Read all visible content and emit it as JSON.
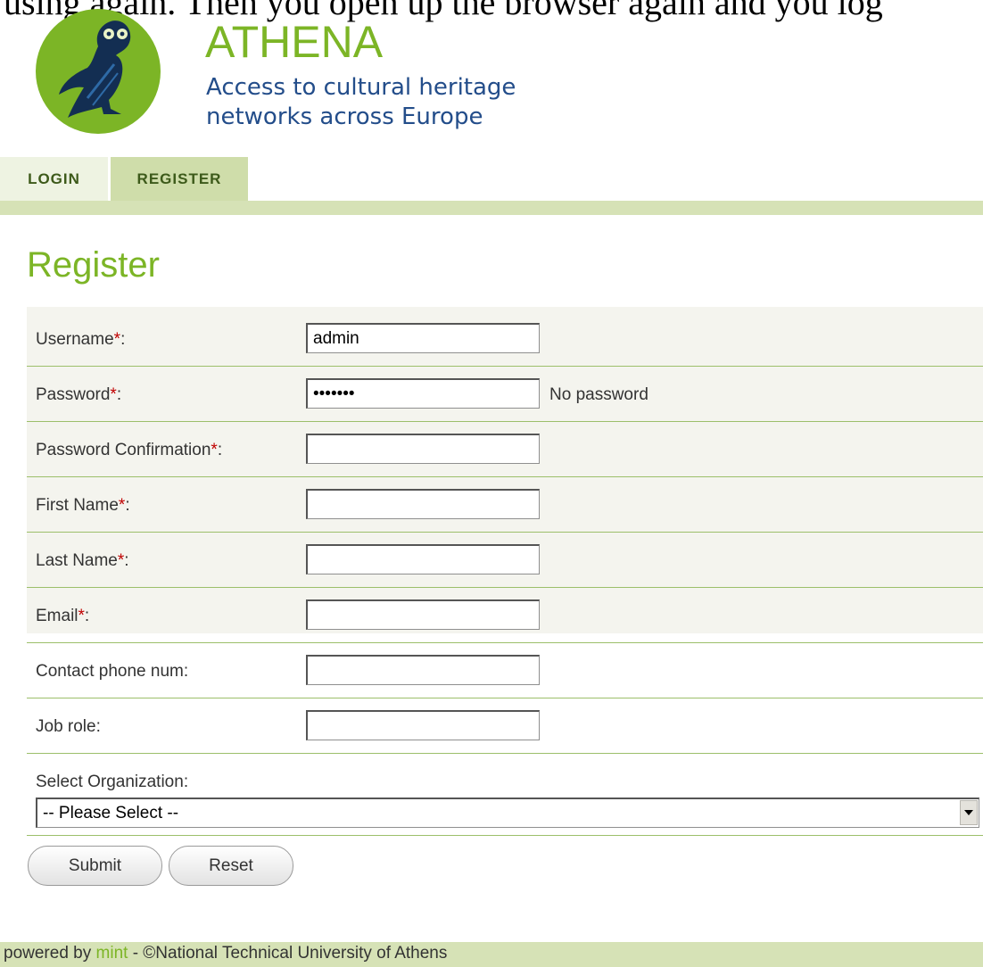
{
  "page_heading_partial": "using again. Then you open up the browser again and you log",
  "brand": {
    "title": "ATHENA",
    "subtitle_line1": "Access to cultural heritage",
    "subtitle_line2": "networks across Europe",
    "logo_icon": "owl-logo-icon",
    "accent_color": "#7cb526"
  },
  "nav": {
    "tabs": [
      {
        "label": "LOGIN"
      },
      {
        "label": "REGISTER"
      }
    ],
    "active_tab": "REGISTER"
  },
  "page_title": "Register",
  "form": {
    "required_marker": "*",
    "username": {
      "label": "Username",
      "value": "admin"
    },
    "password": {
      "label": "Password",
      "value": "1234567",
      "note": "No password"
    },
    "password_confirmation": {
      "label": "Password Confirmation",
      "value": ""
    },
    "first_name": {
      "label": "First Name",
      "value": ""
    },
    "last_name": {
      "label": "Last Name",
      "value": ""
    },
    "email": {
      "label": "Email",
      "value": ""
    },
    "contact_phone": {
      "label": "Contact phone num:",
      "value": ""
    },
    "job_role": {
      "label": "Job role:",
      "value": ""
    },
    "organization": {
      "label": "Select Organization:",
      "selected": "-- Please Select --"
    }
  },
  "buttons": {
    "submit": "Submit",
    "reset": "Reset"
  },
  "footer": {
    "prefix": "powered by ",
    "link": "mint",
    "suffix": " - ©National Technical University of Athens"
  }
}
